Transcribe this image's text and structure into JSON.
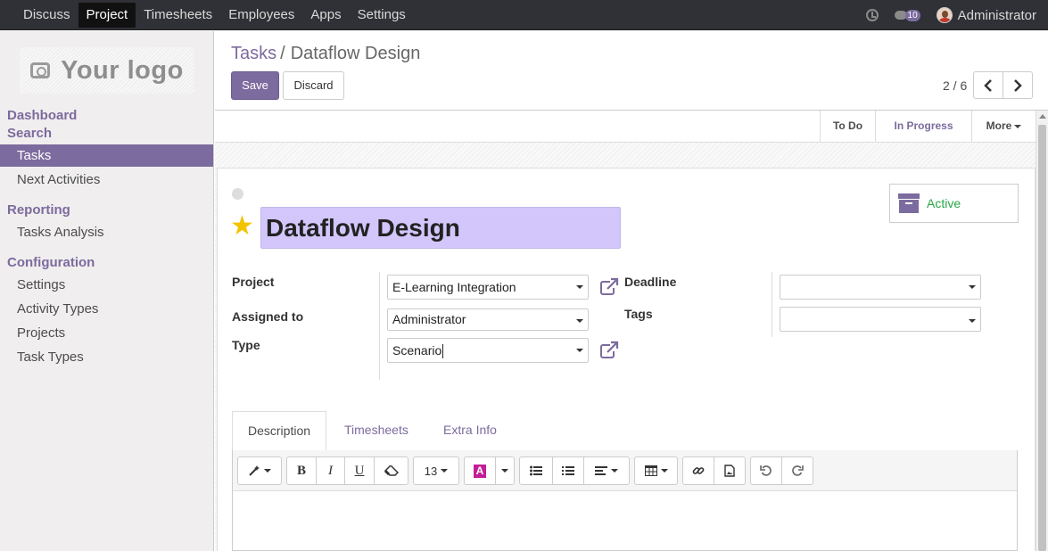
{
  "topbar": {
    "menu": [
      "Discuss",
      "Project",
      "Timesheets",
      "Employees",
      "Apps",
      "Settings"
    ],
    "active_menu": "Project",
    "messages_badge": "10",
    "user": "Administrator"
  },
  "sidebar": {
    "logo_text": "Your logo",
    "dashboard": "Dashboard",
    "search": "Search",
    "search_items": [
      "Tasks",
      "Next Activities"
    ],
    "reporting": "Reporting",
    "reporting_items": [
      "Tasks Analysis"
    ],
    "configuration": "Configuration",
    "configuration_items": [
      "Settings",
      "Activity Types",
      "Projects",
      "Task Types"
    ]
  },
  "control": {
    "breadcrumb_parent": "Tasks",
    "breadcrumb_sep": "/",
    "breadcrumb_current": "Dataflow Design",
    "save_label": "Save",
    "discard_label": "Discard",
    "pager": "2 / 6"
  },
  "statusbar": {
    "stages": [
      "To Do",
      "In Progress"
    ],
    "current_stage": "In Progress",
    "more_label": "More"
  },
  "form": {
    "title": "Dataflow Design",
    "active_label": "Active",
    "project_label": "Project",
    "project_value": "E-Learning Integration",
    "assigned_label": "Assigned to",
    "assigned_value": "Administrator",
    "type_label": "Type",
    "type_value": "Scenario",
    "deadline_label": "Deadline",
    "deadline_value": "",
    "tags_label": "Tags",
    "tags_value": ""
  },
  "tabs": [
    "Description",
    "Timesheets",
    "Extra Info"
  ],
  "editor": {
    "font_size": "13"
  },
  "colors": {
    "brand": "#7c6b9e",
    "title_highlight": "#d2c6fb",
    "star": "#f3c300",
    "active_green": "#28a745"
  }
}
